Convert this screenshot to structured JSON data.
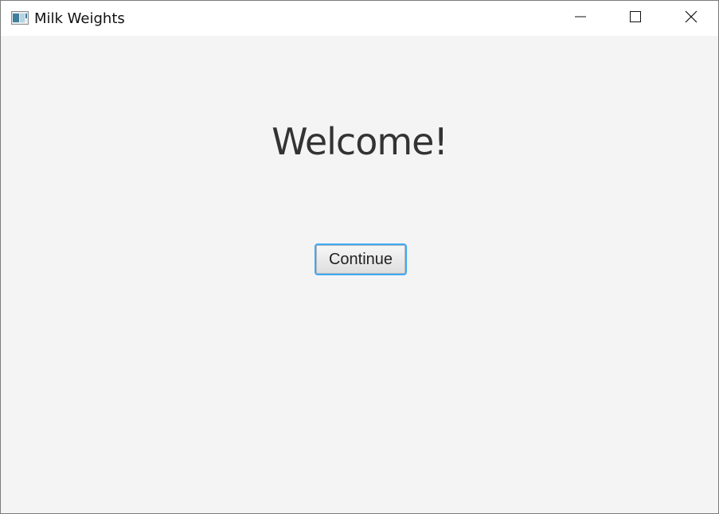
{
  "window": {
    "title": "Milk Weights",
    "app_icon": "app-window-icon",
    "controls": {
      "minimize_icon": "minimize-icon",
      "maximize_icon": "maximize-icon",
      "close_icon": "close-icon"
    }
  },
  "main": {
    "heading": "Welcome!",
    "continue_label": "Continue"
  },
  "colors": {
    "background": "#f4f4f4",
    "titlebar": "#ffffff",
    "text": "#333333",
    "focus_border": "#3fa9f5"
  }
}
